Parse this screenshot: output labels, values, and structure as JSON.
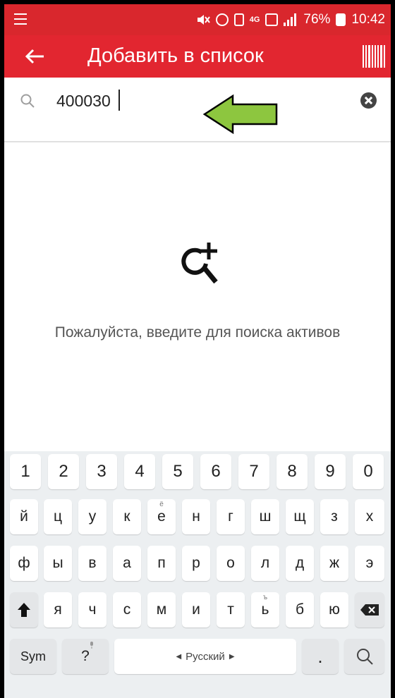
{
  "status_bar": {
    "battery": "76%",
    "time": "10:42",
    "network": "4G"
  },
  "app_bar": {
    "title": "Добавить в список"
  },
  "search": {
    "value": "400030"
  },
  "empty_state": {
    "message": "Пожалуйста, введите для поиска активов"
  },
  "keyboard": {
    "number_row": [
      "1",
      "2",
      "3",
      "4",
      "5",
      "6",
      "7",
      "8",
      "9",
      "0"
    ],
    "row1": [
      "й",
      "ц",
      "у",
      "к",
      "е",
      "н",
      "г",
      "ш",
      "щ",
      "з",
      "х"
    ],
    "row1_sub_e": "ё",
    "row2": [
      "ф",
      "ы",
      "в",
      "а",
      "п",
      "р",
      "о",
      "л",
      "д",
      "ж",
      "э"
    ],
    "row3": [
      "я",
      "ч",
      "с",
      "м",
      "и",
      "т",
      "ь",
      "б",
      "ю"
    ],
    "row3_sub_soft": "ъ",
    "sym_label": "Sym",
    "question_label": "?",
    "space_label": "Русский",
    "period_label": "."
  },
  "colors": {
    "app_bar": "#e22630",
    "status_bar": "#d9272d",
    "annotation_arrow": "#8dc63f"
  }
}
